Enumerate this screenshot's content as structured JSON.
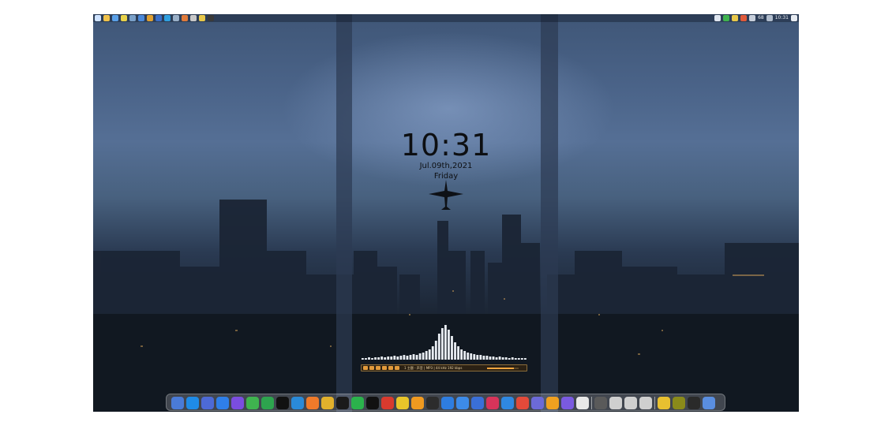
{
  "clock": {
    "time": "10:31",
    "date": "Jul.09th,2021",
    "weekday": "Friday"
  },
  "top_bar": {
    "left_icons": [
      "windows-start",
      "file-manager",
      "browser",
      "notes",
      "app",
      "app",
      "chrome",
      "app",
      "folder",
      "app",
      "app",
      "app",
      "app",
      "app"
    ],
    "right_icons": [
      "tray-app",
      "tray-app",
      "tray-app",
      "tray-app",
      "tray-app",
      "tray-app"
    ],
    "status_text": "68",
    "time": "10:31"
  },
  "media_player": {
    "track_info": "1 主题 - 声音  |  MP3  |  44 kHz  192 kbps",
    "progress": 0.85,
    "visualizer_levels": [
      2,
      2,
      3,
      2,
      3,
      3,
      4,
      3,
      4,
      4,
      5,
      4,
      5,
      6,
      5,
      6,
      7,
      6,
      8,
      9,
      11,
      13,
      17,
      24,
      33,
      40,
      44,
      38,
      30,
      22,
      17,
      13,
      11,
      9,
      8,
      7,
      6,
      6,
      5,
      5,
      4,
      4,
      3,
      4,
      3,
      3,
      2,
      3,
      2,
      2,
      2,
      2
    ]
  },
  "dock": {
    "icons": [
      {
        "name": "finder",
        "color": "#4a7bd8"
      },
      {
        "name": "desktop",
        "color": "#1f8be6"
      },
      {
        "name": "launchpad",
        "color": "#4d6ad6"
      },
      {
        "name": "windows",
        "color": "#2f7fe8"
      },
      {
        "name": "app-purple",
        "color": "#7b4de0"
      },
      {
        "name": "wechat-mini",
        "color": "#3fb34f"
      },
      {
        "name": "evernote",
        "color": "#2da44e"
      },
      {
        "name": "apple",
        "color": "#111111"
      },
      {
        "name": "edge",
        "color": "#2a8ad8"
      },
      {
        "name": "firefox",
        "color": "#ef7a2a"
      },
      {
        "name": "chrome",
        "color": "#e2b12c"
      },
      {
        "name": "qq",
        "color": "#1a1a1a"
      },
      {
        "name": "wechat",
        "color": "#2bb24c"
      },
      {
        "name": "tiktok",
        "color": "#111111"
      },
      {
        "name": "netease-music",
        "color": "#d83a2e"
      },
      {
        "name": "app-yellow",
        "color": "#e8c52a"
      },
      {
        "name": "aimp",
        "color": "#f09a20"
      },
      {
        "name": "potplayer",
        "color": "#2c2c2c"
      },
      {
        "name": "app-blue",
        "color": "#2e7de0"
      },
      {
        "name": "feishu",
        "color": "#3d8be8"
      },
      {
        "name": "app-grid",
        "color": "#3a6fd8"
      },
      {
        "name": "screenshot",
        "color": "#d8345a"
      },
      {
        "name": "search",
        "color": "#2f88e2"
      },
      {
        "name": "app-red",
        "color": "#e24a3a"
      },
      {
        "name": "photos",
        "color": "#6c6ad8"
      },
      {
        "name": "bittorrent",
        "color": "#f0a020"
      },
      {
        "name": "volume",
        "color": "#7a5ae0"
      },
      {
        "name": "app-multi",
        "color": "#e8e8e8"
      },
      {
        "name": "power",
        "color": "#5a5a5a"
      },
      {
        "name": "more",
        "color": "#cfcfcf"
      },
      {
        "name": "chevron-down",
        "color": "#cfcfcf"
      },
      {
        "name": "chevron-down-2",
        "color": "#cfcfcf"
      },
      {
        "name": "color-picker",
        "color": "#e8c030"
      },
      {
        "name": "fireworks",
        "color": "#8a8a1a"
      },
      {
        "name": "obs",
        "color": "#2a2a2a"
      },
      {
        "name": "recycle-bin",
        "color": "#5a8ee0"
      }
    ]
  }
}
